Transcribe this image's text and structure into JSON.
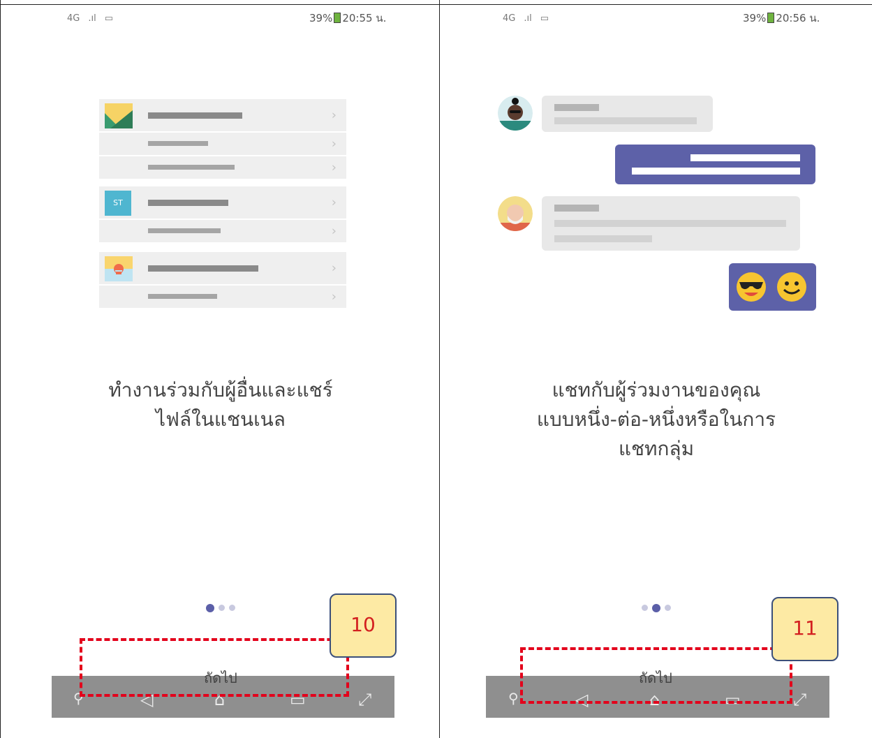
{
  "left": {
    "status": {
      "network": "4G",
      "signal": "signal-bars-icon",
      "notify": "image-icon",
      "right": "39%",
      "time": "20:55 น."
    },
    "caption_lines": [
      "ทำงานร่วมกับผู้อื่นและแชร์",
      "ไฟล์ในแชนเนล"
    ],
    "thumb_label": "ST",
    "page_index": 0,
    "page_count": 3,
    "next_label": "ถัดไป",
    "badge": "10"
  },
  "right": {
    "status": {
      "network": "4G",
      "signal": "signal-bars-icon",
      "notify": "image-icon",
      "right": "39%",
      "time": "20:56 น."
    },
    "caption_lines": [
      "แชทกับผู้ร่วมงานของคุณ",
      "แบบหนึ่ง-ต่อ-หนึ่งหรือในการ",
      "แชทกลุ่ม"
    ],
    "page_index": 1,
    "page_count": 3,
    "next_label": "ถัดไป",
    "badge": "11"
  },
  "colors": {
    "accent": "#5D61A8",
    "highlight_box": "#E3001B",
    "badge_fill": "#FDEAA4",
    "navbar": "#8F8F8F"
  },
  "nav_icons": [
    "pin-icon",
    "back-icon",
    "home-icon",
    "recents-icon",
    "expand-icon"
  ]
}
